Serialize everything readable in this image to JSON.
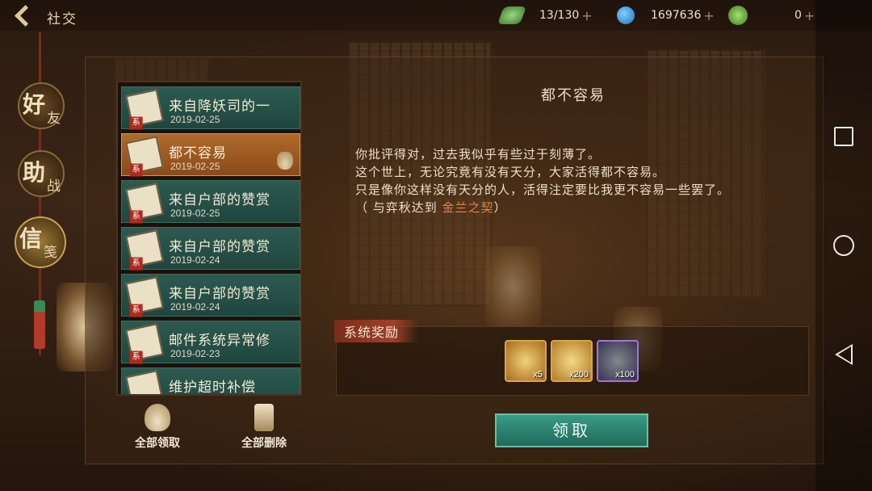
{
  "header": {
    "title": "社交",
    "resources": [
      {
        "name": "jade",
        "value": "13/130",
        "icon": "jade-icon"
      },
      {
        "name": "gourd",
        "value": "1697636",
        "icon": "gourd-icon"
      },
      {
        "name": "coin",
        "value": "0",
        "icon": "coin-icon"
      }
    ],
    "plus": "+"
  },
  "side_tabs": [
    {
      "big": "好",
      "small": "友"
    },
    {
      "big": "助",
      "small": "战"
    },
    {
      "big": "信",
      "small": "笺",
      "active": true
    }
  ],
  "mail_list": [
    {
      "title": "来自降妖司的一",
      "date": "2019-02-25"
    },
    {
      "title": "都不容易",
      "date": "2019-02-25",
      "active": true
    },
    {
      "title": "来自户部的赞赏",
      "date": "2019-02-25"
    },
    {
      "title": "来自户部的赞赏",
      "date": "2019-02-24"
    },
    {
      "title": "来自户部的赞赏",
      "date": "2019-02-24"
    },
    {
      "title": "邮件系统异常修",
      "date": "2019-02-23"
    },
    {
      "title": "维护超时补偿",
      "date": ""
    }
  ],
  "actions": {
    "claim_all": "全部领取",
    "delete_all": "全部删除"
  },
  "mail": {
    "subject": "都不容易",
    "lines": [
      "你批评得对，过去我似乎有些过于刻薄了。",
      "这个世上，无论究竟有没有天分，大家活得都不容易。",
      "只是像你这样没有天分的人，活得注定要比我更不容易一些罢了。"
    ],
    "note_prefix": "（ 与弈秋达到 ",
    "note_highlight": "金兰之契",
    "note_suffix": "）"
  },
  "rewards": {
    "label": "系统奖励",
    "items": [
      {
        "icon": "scroll-item-icon",
        "qty": "x5"
      },
      {
        "icon": "gold-ingot-icon",
        "qty": "x200"
      },
      {
        "icon": "jade-token-icon",
        "qty": "x100"
      }
    ]
  },
  "claim_button": "领取",
  "colors": {
    "accent_teal": "#1f6a5a",
    "active_orange": "#b06a2a",
    "highlight": "#e0834a"
  }
}
